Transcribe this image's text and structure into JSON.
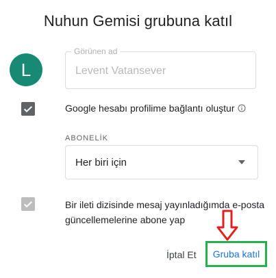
{
  "dialog": {
    "title": "Nuhun Gemisi grubuna katıl"
  },
  "avatar": {
    "initial": "L",
    "color": "#188a73"
  },
  "display_name": {
    "label": "Görünen ad",
    "value": "Levent Vatansever"
  },
  "profile_link": {
    "checked": true,
    "label": "Google hesabı profilime bağlantı oluştur",
    "info_icon": "info-icon"
  },
  "subscription": {
    "section_label": "ABONELİK",
    "selected": "Her biri için",
    "dropdown_icon": "caret-down-icon"
  },
  "thread_updates": {
    "checked": true,
    "disabled": true,
    "label": "Bir ileti dizisinde mesaj yayınladığımda e-posta güncellemelerine abone yap"
  },
  "actions": {
    "cancel_label": "İptal Et",
    "join_label": "Gruba katıl"
  },
  "colors": {
    "accent_blue": "#1a73e8",
    "highlight_green": "#21b24b",
    "annotation_red": "#e02020"
  }
}
